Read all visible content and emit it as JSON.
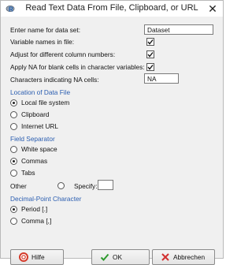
{
  "window": {
    "title": "Read Text Data From File, Clipboard, or URL"
  },
  "dataset": {
    "label": "Enter name for data set:",
    "value": "Dataset"
  },
  "options": {
    "varnames_label": "Variable names in file:",
    "varnames_checked": true,
    "adjust_label": "Adjust for different column numbers:",
    "adjust_checked": true,
    "na_blank_label": "Apply NA for blank cells in character variables:",
    "na_blank_checked": true,
    "na_chars_label": "Characters indicating NA cells:",
    "na_chars_value": "NA"
  },
  "location": {
    "title": "Location of Data File",
    "options": [
      "Local file system",
      "Clipboard",
      "Internet URL"
    ],
    "selected": "Local file system"
  },
  "separator": {
    "title": "Field Separator",
    "options": [
      "White space",
      "Commas",
      "Tabs"
    ],
    "selected": "Commas",
    "other_label": "Other",
    "specify_label": "Specify:",
    "specify_value": ""
  },
  "decimal": {
    "title": "Decimal-Point Character",
    "options": [
      "Period [.]",
      "Comma [,]"
    ],
    "selected": "Period [.]"
  },
  "buttons": {
    "help": "Hilfe",
    "ok": "OK",
    "cancel": "Abbrechen"
  },
  "colors": {
    "section_title": "#2a5db0",
    "ok_check": "#2e9a2e",
    "cancel_x": "#d23030",
    "help_ring": "#d43a2a"
  },
  "icons": [
    "r-app-icon",
    "close-icon",
    "help-icon",
    "ok-check-icon",
    "cancel-x-icon"
  ]
}
